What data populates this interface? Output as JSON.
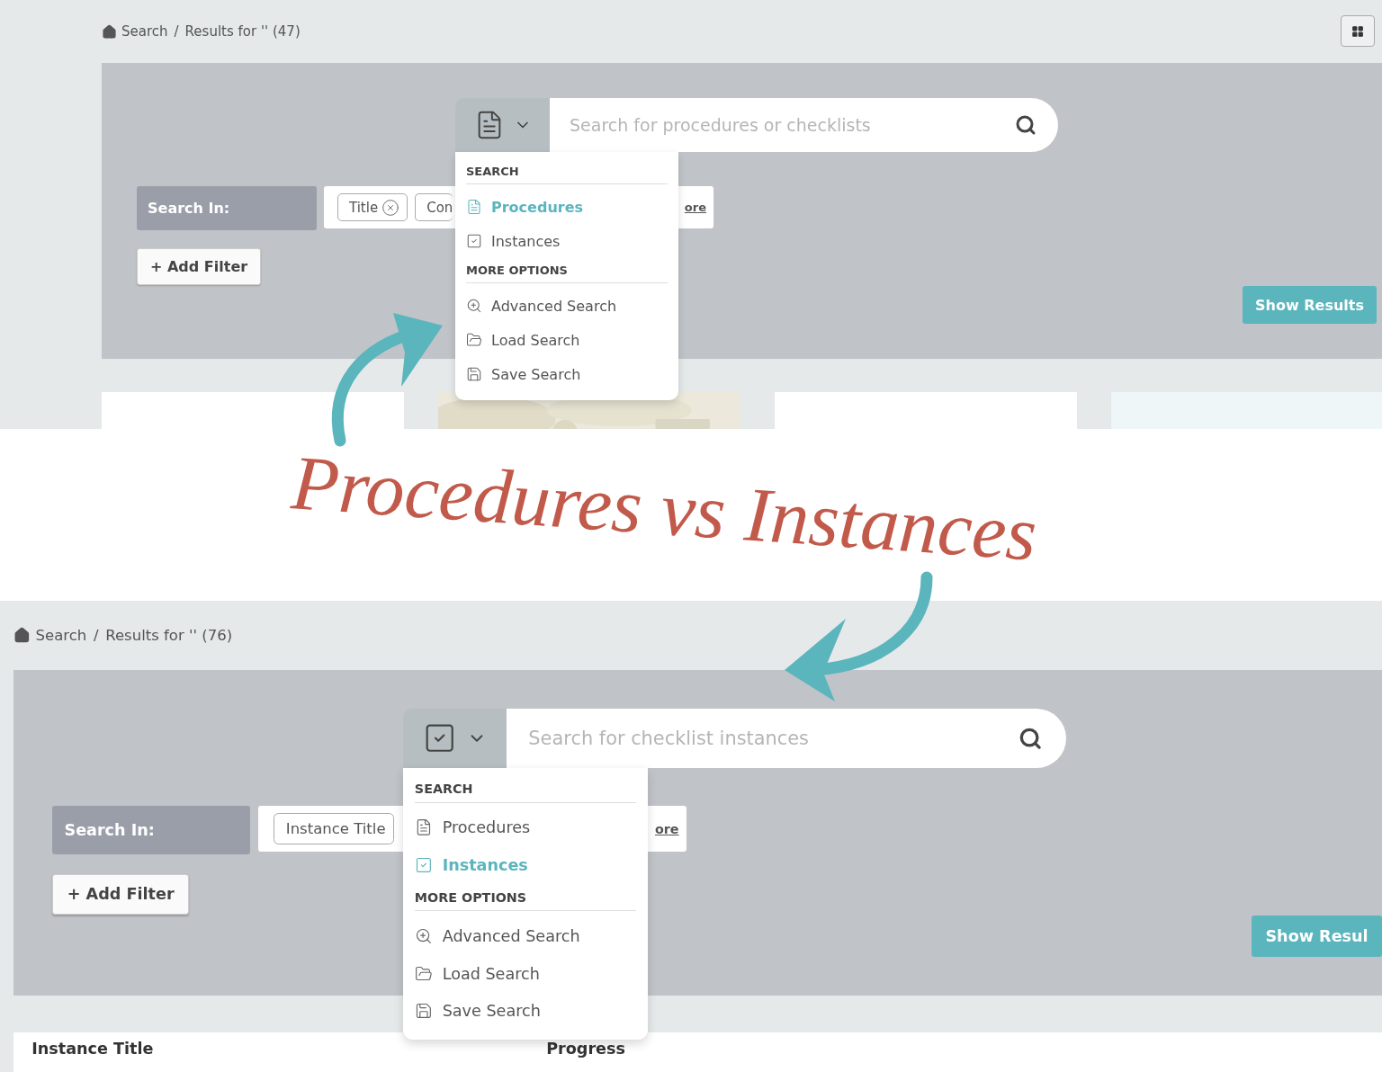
{
  "panels": [
    {
      "breadcrumb": {
        "root": "Search",
        "separator": "/",
        "current": "Results for '' (47)"
      },
      "grid_button": true,
      "search": {
        "kind": "procedures",
        "placeholder": "Search for procedures or checklists"
      },
      "menu": {
        "sections": [
          {
            "heading": "SEARCH",
            "items": [
              {
                "label": "Procedures",
                "selected": true
              },
              {
                "label": "Instances",
                "selected": false
              }
            ]
          },
          {
            "heading": "MORE OPTIONS",
            "items": [
              {
                "label": "Advanced Search"
              },
              {
                "label": "Load Search"
              },
              {
                "label": "Save Search"
              }
            ]
          }
        ]
      },
      "filters": {
        "label": "Search In:",
        "chips": [
          {
            "label": "Title",
            "removable": true
          },
          {
            "label": "Con",
            "removable": false
          }
        ],
        "more_link": "ore"
      },
      "add_filter": "+ Add Filter",
      "show_results": "Show Results",
      "results": {
        "kind": "cards",
        "cards": [
          {
            "kind": "plain"
          },
          {
            "kind": "picture"
          },
          {
            "kind": "plain"
          },
          {
            "kind": "tinted"
          }
        ]
      }
    },
    {
      "breadcrumb": {
        "root": "Search",
        "separator": "/",
        "current": "Results for '' (76)"
      },
      "search": {
        "kind": "instances",
        "placeholder": "Search for checklist instances"
      },
      "menu": {
        "sections": [
          {
            "heading": "SEARCH",
            "items": [
              {
                "label": "Procedures",
                "selected": false
              },
              {
                "label": "Instances",
                "selected": true
              }
            ]
          },
          {
            "heading": "MORE OPTIONS",
            "items": [
              {
                "label": "Advanced Search"
              },
              {
                "label": "Load Search"
              },
              {
                "label": "Save Search"
              }
            ]
          }
        ]
      },
      "filters": {
        "label": "Search In:",
        "chips": [
          {
            "label": "Instance Title",
            "removable": false
          }
        ],
        "more_link": "ore"
      },
      "add_filter": "+ Add Filter",
      "show_results": "Show Resul",
      "results": {
        "kind": "table",
        "columns": [
          "Instance Title",
          "Progress"
        ]
      }
    }
  ],
  "title": "Procedures vs Instances"
}
